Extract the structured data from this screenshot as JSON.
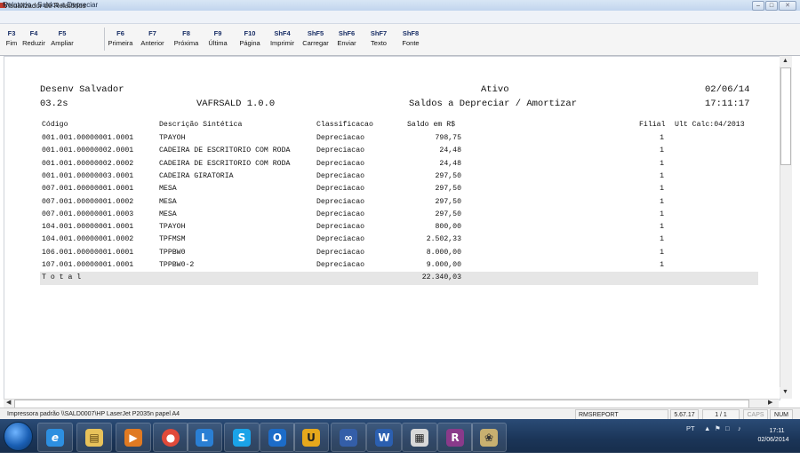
{
  "window": {
    "title": "Relatorio - Saldos a Depreciar",
    "menu_label": "Visualizador de Relatórios"
  },
  "toolbar": [
    {
      "key": "F3",
      "label": "Fim"
    },
    {
      "key": "F4",
      "label": "Reduzir"
    },
    {
      "key": "F5",
      "label": "Ampliar"
    },
    {
      "key": "F6",
      "label": "Primeira"
    },
    {
      "key": "F7",
      "label": "Anterior"
    },
    {
      "key": "F8",
      "label": "Próxima"
    },
    {
      "key": "F9",
      "label": "Última"
    },
    {
      "key": "F10",
      "label": "Página"
    },
    {
      "key": "ShF4",
      "label": "Imprimir"
    },
    {
      "key": "ShF5",
      "label": "Carregar"
    },
    {
      "key": "ShF6",
      "label": "Enviar"
    },
    {
      "key": "ShF7",
      "label": "Texto"
    },
    {
      "key": "ShF8",
      "label": "Fonte"
    }
  ],
  "report": {
    "company": "Desenv Salvador",
    "version": "03.2s",
    "program": "VAFRSALD 1.0.0",
    "status": "Ativo",
    "subtitle": "Saldos a Depreciar / Amortizar",
    "date": "02/06/14",
    "time": "17:11:17",
    "columns": {
      "code": "Código",
      "description": "Descrição Sintética",
      "classification": "Classificacao",
      "balance": "Saldo em R$",
      "branch": "Filial",
      "last_calc": "Ult Calc:04/2013"
    },
    "rows": [
      {
        "code": "001.001.00000001.0001",
        "description": "TPAYOH",
        "classification": "Depreciacao",
        "balance": "798,75",
        "branch": "1"
      },
      {
        "code": "001.001.00000002.0001",
        "description": "CADEIRA DE ESCRITORIO COM RODA",
        "classification": "Depreciacao",
        "balance": "24,48",
        "branch": "1"
      },
      {
        "code": "001.001.00000002.0002",
        "description": "CADEIRA DE ESCRITORIO COM RODA",
        "classification": "Depreciacao",
        "balance": "24,48",
        "branch": "1"
      },
      {
        "code": "001.001.00000003.0001",
        "description": "CADEIRA GIRATORIA",
        "classification": "Depreciacao",
        "balance": "297,50",
        "branch": "1"
      },
      {
        "code": "007.001.00000001.0001",
        "description": "MESA",
        "classification": "Depreciacao",
        "balance": "297,50",
        "branch": "1"
      },
      {
        "code": "007.001.00000001.0002",
        "description": "MESA",
        "classification": "Depreciacao",
        "balance": "297,50",
        "branch": "1"
      },
      {
        "code": "007.001.00000001.0003",
        "description": "MESA",
        "classification": "Depreciacao",
        "balance": "297,50",
        "branch": "1"
      },
      {
        "code": "104.001.00000001.0001",
        "description": "TPAYOH",
        "classification": "Depreciacao",
        "balance": "800,00",
        "branch": "1"
      },
      {
        "code": "104.001.00000001.0002",
        "description": "TPFMSM",
        "classification": "Depreciacao",
        "balance": "2.502,33",
        "branch": "1"
      },
      {
        "code": "106.001.00000001.0001",
        "description": "TPPBW0",
        "classification": "Depreciacao",
        "balance": "8.000,00",
        "branch": "1"
      },
      {
        "code": "107.001.00000001.0001",
        "description": "TPPBW0-2",
        "classification": "Depreciacao",
        "balance": "9.000,00",
        "branch": "1"
      }
    ],
    "total_label": "T o t a l",
    "total_value": "22.340,03"
  },
  "statusbar": {
    "printer": "Impressora padrão \\\\SALD0007\\HP LaserJet P2035n papel A4",
    "module": "RMSREPORT",
    "version": "5.67.17",
    "page": "1 / 1",
    "caps": "CAPS",
    "num": "NUM"
  },
  "taskbar": {
    "apps": [
      "internet-explorer",
      "file-explorer",
      "media-player",
      "chrome",
      "lync",
      "skype",
      "outlook",
      "ultraedit",
      "connectivity",
      "word",
      "crossword-app",
      "winrar",
      "paint"
    ],
    "language": "PT",
    "time": "17:11",
    "date": "02/06/2014"
  },
  "colors": {
    "taskbar": "#1b3558",
    "toolbar_key": "#1a2f66",
    "total_bar": "#e6e6e6"
  }
}
